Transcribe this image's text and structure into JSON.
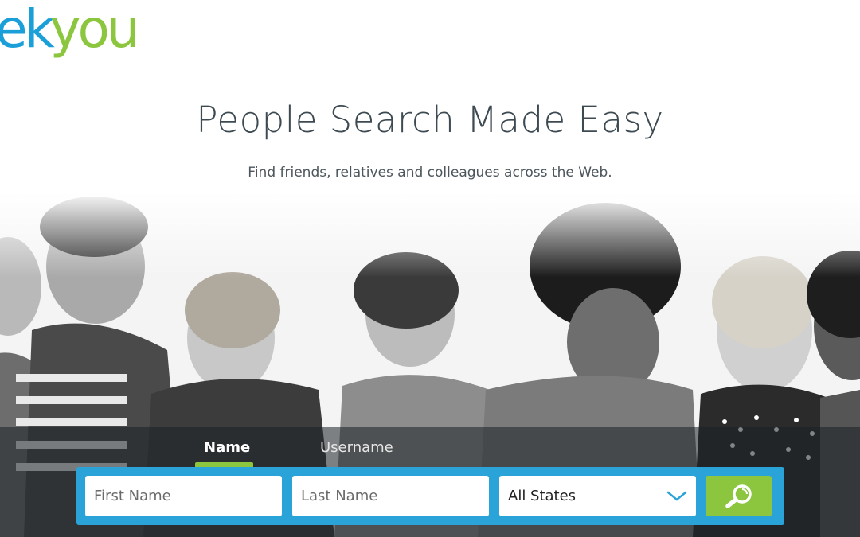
{
  "logo": {
    "text_a": "ek",
    "text_b": "you"
  },
  "hero": {
    "title": "People Search Made Easy",
    "subtitle": "Find friends, relatives and colleagues across the Web."
  },
  "tabs": [
    {
      "label": "Name",
      "active": true
    },
    {
      "label": "Username",
      "active": false
    }
  ],
  "search": {
    "first_name_placeholder": "First Name",
    "last_name_placeholder": "Last Name",
    "state_value": "All States",
    "submit_icon": "search-icon"
  },
  "colors": {
    "brand_blue": "#1a9fd9",
    "brand_green": "#8cc63f",
    "form_blue": "#2aa3d9"
  }
}
